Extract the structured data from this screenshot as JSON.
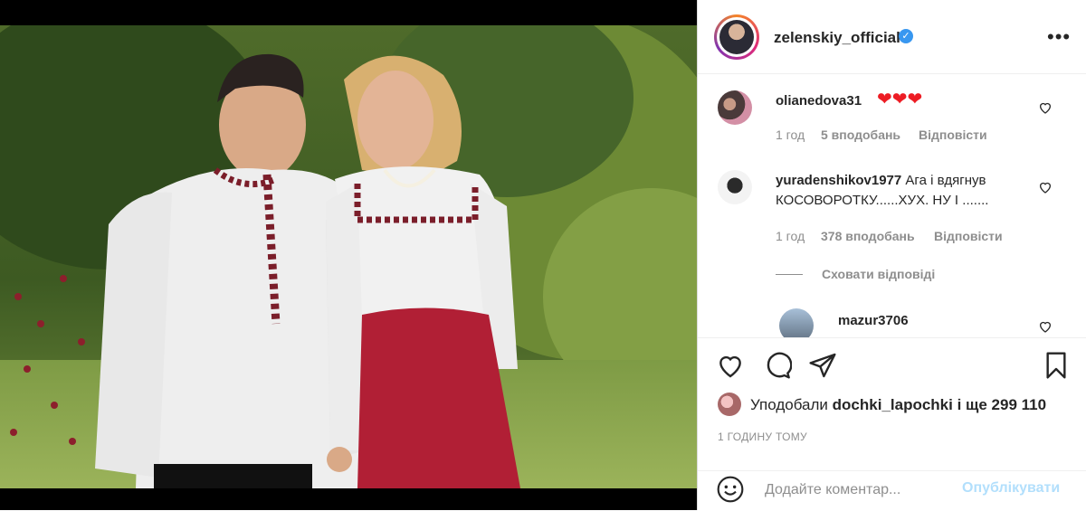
{
  "post": {
    "username": "zelenskiy_official",
    "verified_icon": "verified-badge-icon",
    "more_icon": "more-options-icon"
  },
  "comments": [
    {
      "user": "olianedova31",
      "text": "❤❤❤",
      "time": "1 год",
      "likes": "5 вподобань",
      "reply": "Відповісти"
    },
    {
      "user": "yuradenshikov1977",
      "text": "Ага і вдягнув КОСОВОРОТКУ......ХУХ. НУ І .......",
      "time": "1 год",
      "likes": "378 вподобань",
      "reply": "Відповісти"
    }
  ],
  "hide_replies": "Сховати відповіді",
  "reply_user": "mazur3706",
  "likes_line": {
    "prefix": "Уподобали",
    "user": "dochki_lapochki",
    "suffix": "і ще 299 110"
  },
  "timestamp": "1 ГОДИНУ ТОМУ",
  "comment_input": {
    "placeholder": "Додайте коментар..."
  },
  "publish_label": "Опублікувати",
  "colors": {
    "accent": "#3897f0",
    "heart": "#ed1c24",
    "publish_disabled": "#b2dffc",
    "muted": "#8e8e8e"
  }
}
